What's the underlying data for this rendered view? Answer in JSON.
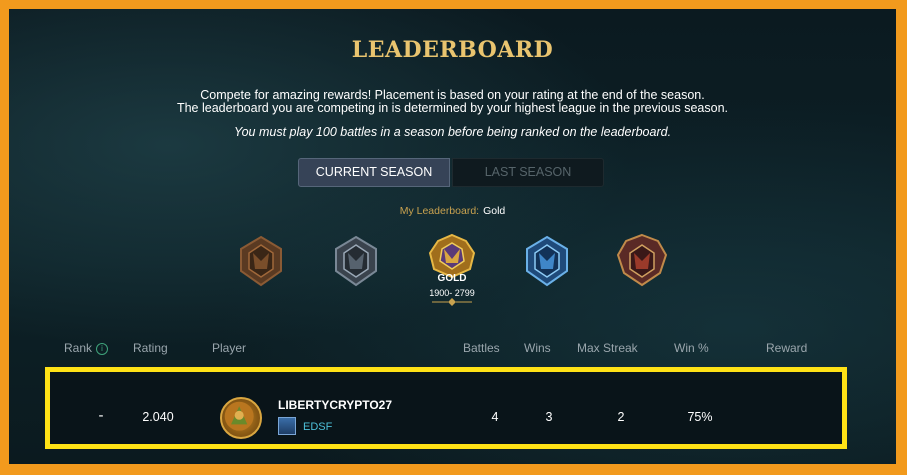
{
  "title": "LEADERBOARD",
  "description": {
    "line1": "Compete for amazing rewards! Placement is based on your rating at the end of the season.",
    "line2": "The leaderboard you are competing in is determined by your highest league in the previous season.",
    "note": "You must play 100 battles in a season before being ranked on the leaderboard."
  },
  "tabs": [
    {
      "label": "CURRENT SEASON",
      "active": true
    },
    {
      "label": "LAST SEASON",
      "active": false
    }
  ],
  "my_leaderboard": {
    "label": "My Leaderboard:",
    "value": "Gold"
  },
  "leagues": [
    {
      "icon": "bronze-league-icon"
    },
    {
      "icon": "silver-league-icon"
    },
    {
      "icon": "gold-league-icon",
      "name": "GOLD",
      "range": "1900- 2799",
      "selected": true
    },
    {
      "icon": "diamond-league-icon"
    },
    {
      "icon": "champion-league-icon"
    }
  ],
  "columns": {
    "rank": "Rank",
    "rating": "Rating",
    "player": "Player",
    "battles": "Battles",
    "wins": "Wins",
    "max_streak": "Max Streak",
    "win_pct": "Win %",
    "reward": "Reward"
  },
  "row": {
    "rank": "-",
    "rating": "2.040",
    "player": "LIBERTYCRYPTO27",
    "guild": "EDSF",
    "battles": "4",
    "wins": "3",
    "max_streak": "2",
    "win_pct": "75%",
    "reward": ""
  },
  "colors": {
    "page_border": "#f29a1d",
    "title_gold": "#e9c46f",
    "highlight_border": "#ffe216",
    "guild_text": "#4dbfd8"
  }
}
